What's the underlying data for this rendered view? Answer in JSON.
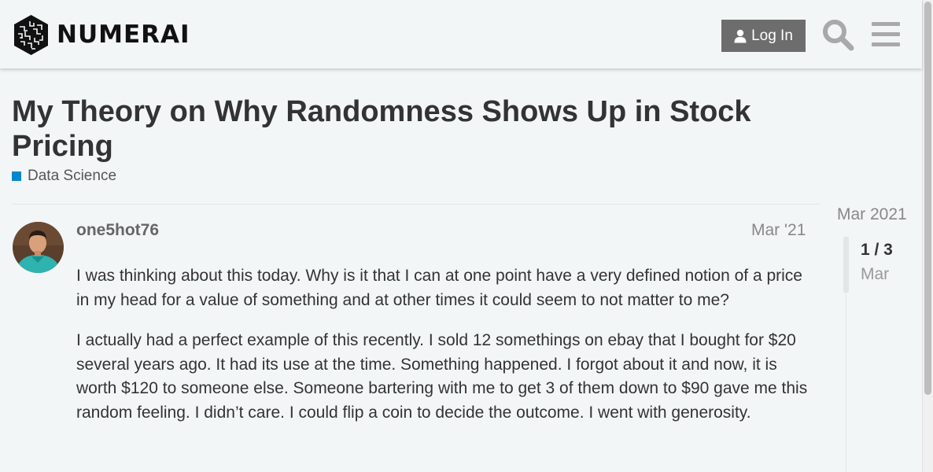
{
  "header": {
    "logo_text": "NUMERAI",
    "login_label": "Log In",
    "icons": {
      "user": "user-icon",
      "search": "search-icon",
      "menu": "hamburger-menu-icon"
    }
  },
  "topic": {
    "title": "My Theory on Why Randomness Shows Up in Stock Pricing",
    "category": {
      "name": "Data Science",
      "color": "#0088cc"
    }
  },
  "post": {
    "username": "one5hot76",
    "date": "Mar '21",
    "paragraphs": [
      "I was thinking about this today. Why is it that I can at one point have a very defined notion of a price in my head for a value of something and at other times it could seem to not matter to me?",
      "I actually had a perfect example of this recently. I sold 12 somethings on ebay that I bought for $20 several years ago. It had its use at the time. Something happened. I forgot about it and now, it is worth $120 to someone else. Someone bartering with me to get 3 of them down to $90 gave me this random feeling. I didn’t care. I could flip a coin to decide the outcome. I went with generosity."
    ]
  },
  "timeline": {
    "start_date": "Mar 2021",
    "position": "1 / 3",
    "position_date": "Mar"
  },
  "colors": {
    "background": "#f3f6f7",
    "login_button": "#6d6d6d",
    "category_accent": "#0088cc"
  }
}
